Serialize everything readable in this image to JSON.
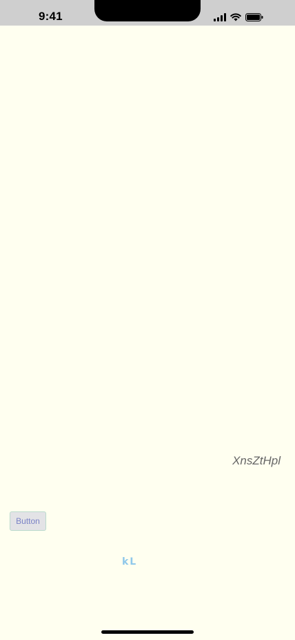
{
  "status_bar": {
    "time": "9:41",
    "icons": [
      "cellular-signal-icon",
      "wifi-icon",
      "battery-icon"
    ]
  },
  "content": {
    "italic_label": "XnsZtHpl",
    "button_label": "Button",
    "kl_label": "kL"
  },
  "colors": {
    "background": "#fffff0",
    "status_bar_background": "#cfcfcf",
    "button_background": "#e3e3e6",
    "button_text": "#7a82c6",
    "kl_text": "#8fc8ea",
    "italic_text": "#666666"
  }
}
